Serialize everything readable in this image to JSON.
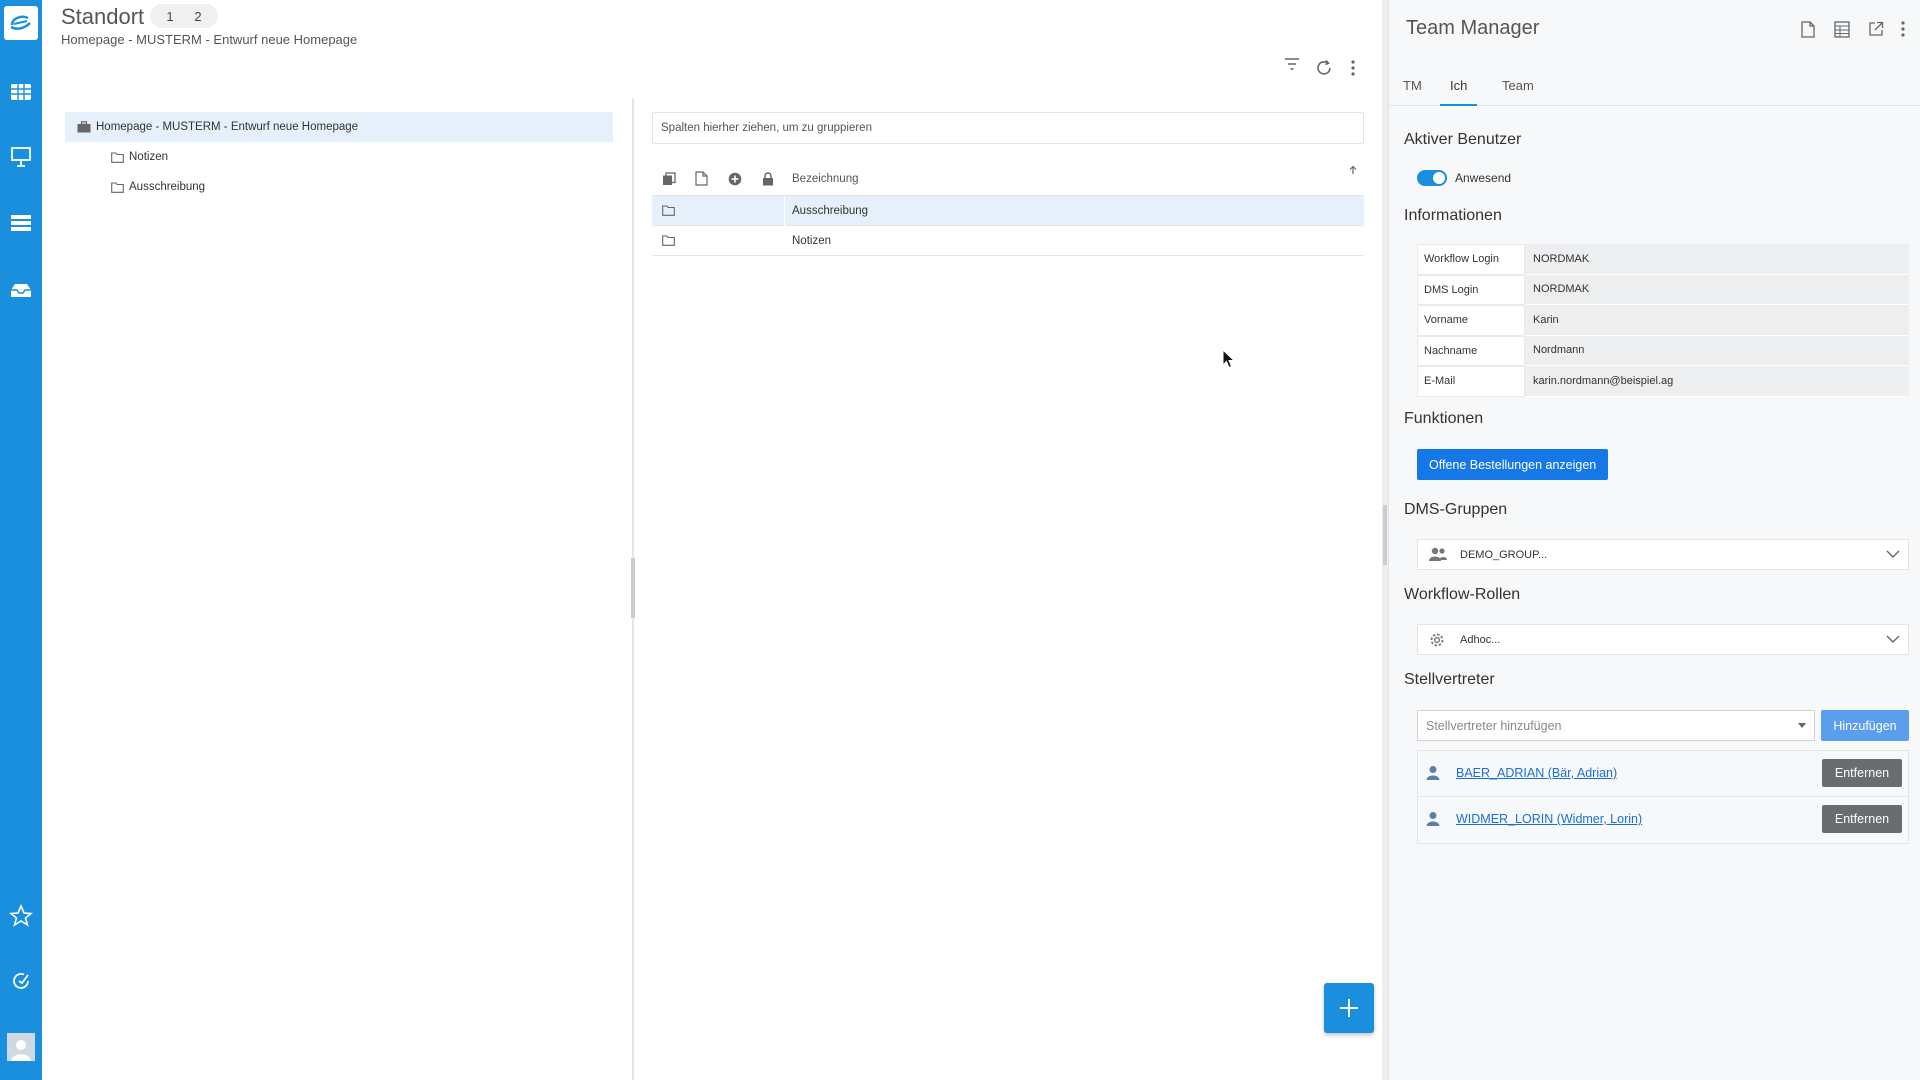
{
  "main": {
    "title": "Standort",
    "pages": [
      "1",
      "2"
    ],
    "subtitle": "Homepage - MUSTERM - Entwurf neue Homepage"
  },
  "tree": {
    "root": "Homepage - MUSTERM - Entwurf neue Homepage",
    "children": [
      "Notizen",
      "Ausschreibung"
    ]
  },
  "grid": {
    "group_placeholder": "Spalten hierher ziehen, um zu gruppieren",
    "column_header": "Bezeichnung",
    "rows": [
      "Ausschreibung",
      "Notizen"
    ]
  },
  "side": {
    "title": "Team Manager",
    "tabs": [
      "TM",
      "Ich",
      "Team"
    ],
    "active_tab": "Ich",
    "sections": {
      "active_user": "Aktiver Benutzer",
      "info": "Informationen",
      "functions": "Funktionen",
      "dms_groups": "DMS-Gruppen",
      "workflow_roles": "Workflow-Rollen",
      "deputies": "Stellvertreter"
    },
    "presence_label": "Anwesend",
    "info_rows": [
      {
        "key": "Workflow Login",
        "value": "NORDMAK"
      },
      {
        "key": "DMS Login",
        "value": "NORDMAK"
      },
      {
        "key": "Vorname",
        "value": "Karin"
      },
      {
        "key": "Nachname",
        "value": "Nordmann"
      },
      {
        "key": "E-Mail",
        "value": "karin.nordmann@beispiel.ag"
      }
    ],
    "functions_button": "Offene Bestellungen anzeigen",
    "dms_group_value": "DEMO_GROUP...",
    "workflow_role_value": "Adhoc...",
    "deputy_placeholder": "Stellvertreter hinzufügen",
    "add_button": "Hinzufügen",
    "deputies": [
      {
        "name": "BAER_ADRIAN (Bär, Adrian)",
        "action": "Entfernen"
      },
      {
        "name": "WIDMER_LORIN (Widmer, Lorin)",
        "action": "Entfernen"
      }
    ]
  },
  "colors": {
    "accent": "#1a8fdd",
    "primary_button": "#1677e6",
    "selection": "#e6f0fa"
  },
  "icons": {
    "rail": [
      "app-logo-icon",
      "database-icon",
      "presentation-icon",
      "list-icon",
      "inbox-icon",
      "star-icon",
      "refresh-check-icon",
      "user-avatar-icon"
    ]
  }
}
